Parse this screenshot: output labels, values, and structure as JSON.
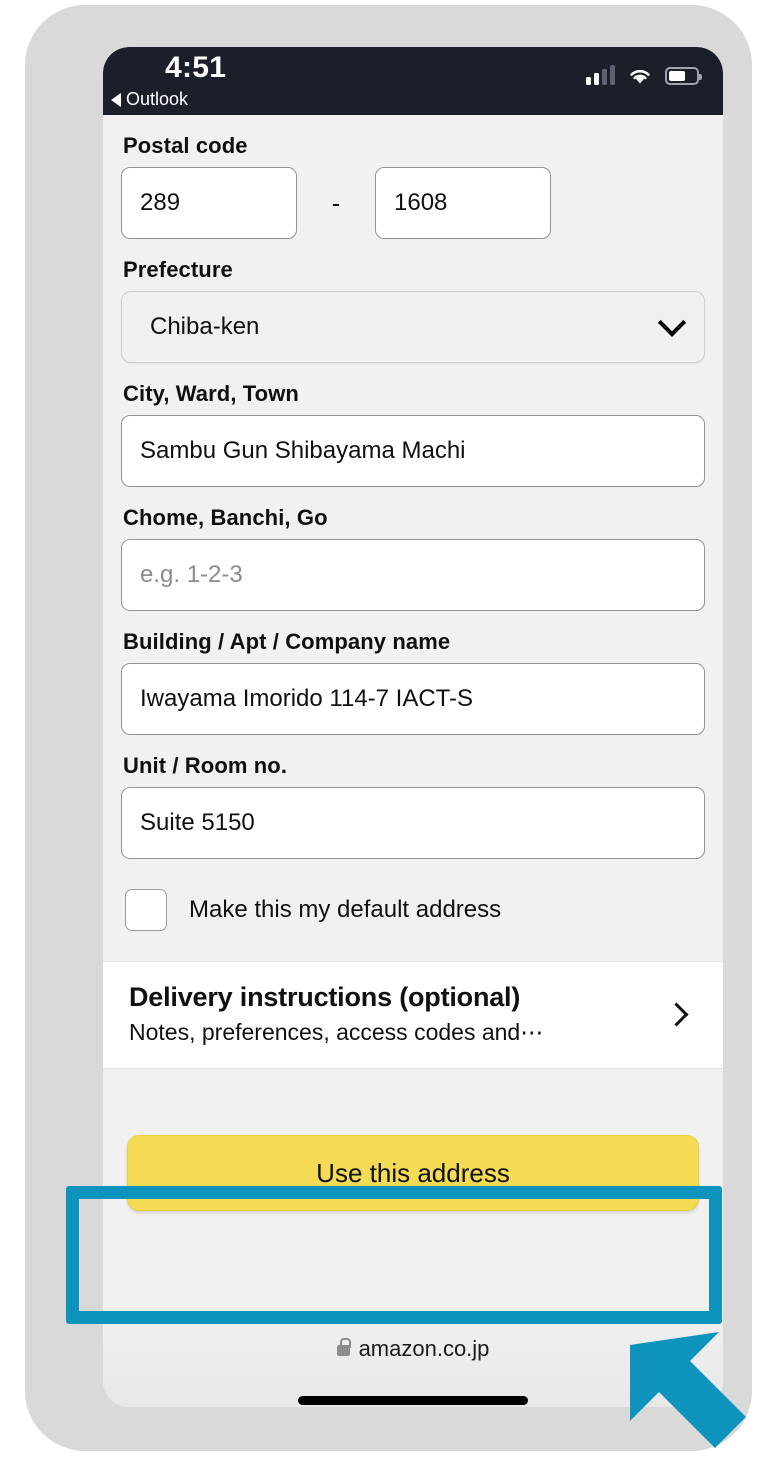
{
  "status_bar": {
    "time": "4:51",
    "back_app": "Outlook",
    "icons": [
      "signal-icon",
      "wifi-icon",
      "battery-icon"
    ],
    "battery_level_pct": 62
  },
  "form": {
    "postal": {
      "label": "Postal code",
      "separator": "-",
      "part1_value": "289",
      "part2_value": "1608"
    },
    "prefecture": {
      "label": "Prefecture",
      "selected": "Chiba-ken",
      "icon": "chevron-down-icon"
    },
    "city": {
      "label": "City, Ward, Town",
      "value": "Sambu Gun Shibayama Machi"
    },
    "chome": {
      "label": "Chome, Banchi, Go",
      "value": "",
      "placeholder": "e.g. 1-2-3"
    },
    "building": {
      "label": "Building / Apt / Company name",
      "value": "Iwayama Imorido 114-7 IACT-S"
    },
    "unit": {
      "label": "Unit / Room no.",
      "value": "Suite 5150"
    },
    "default_checkbox": {
      "label": "Make this my default address",
      "checked": false
    }
  },
  "delivery_card": {
    "title": "Delivery instructions (optional)",
    "subtitle": "Notes, preferences, access codes and⋯",
    "icon": "chevron-right-icon"
  },
  "cta": {
    "label": "Use this address"
  },
  "browser": {
    "url": "amazon.co.jp",
    "icon": "lock-icon"
  },
  "annotation": {
    "highlight_color": "#0e93bd",
    "arrow": "up-left-arrow",
    "target": "use-this-address-button"
  },
  "colors": {
    "accent_yellow": "#f5da53",
    "highlight_teal": "#0e93bd",
    "status_bar_bg": "#1b1f2a",
    "page_bg": "#f1f1f1",
    "bezel": "#d9d9d9"
  }
}
